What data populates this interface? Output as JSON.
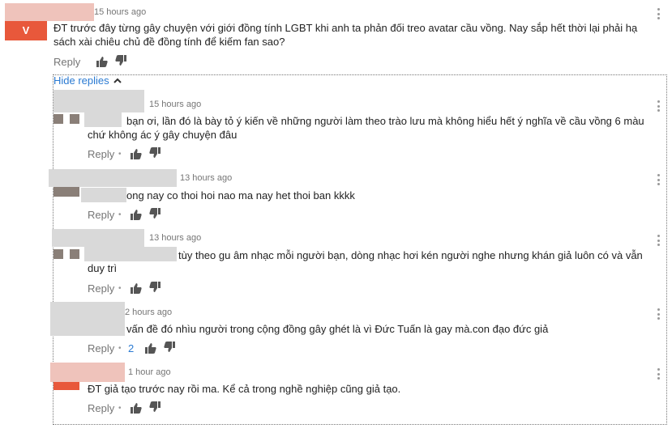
{
  "top_comment": {
    "avatar_letter": "V",
    "time": "15 hours ago",
    "text_line1": "ĐT trước đây từng gây chuyện với giới đồng tính LGBT khi anh ta phản đối treo avatar cầu vồng. Nay sắp hết thời lại phải hạ",
    "text_line2": "sách xài chiêu chủ đề đồng tính để kiếm fan sao?",
    "reply_label": "Reply"
  },
  "hide_replies_label": "Hide replies",
  "replies": [
    {
      "time": "15 hours ago",
      "text_line1": "bạn ơi, lần đó là bày tỏ ý kiến về những người làm theo trào lưu mà không hiểu hết ý nghĩa về cầu vồng 6 màu",
      "text_line2": "chứ không ác ý gây chuyện đâu",
      "reply_label": "Reply",
      "separator": "•"
    },
    {
      "time": "13 hours ago",
      "text_line1": "ong nay co thoi hoi nao ma nay het thoi ban kkkk",
      "reply_label": "Reply",
      "separator": "•"
    },
    {
      "time": "13 hours ago",
      "text_line1": "tùy theo gu âm nhạc mỗi người bạn, dòng nhạc hơi kén người nghe nhưng khán giả luôn có và vẫn",
      "text_line2": "duy trì",
      "reply_label": "Reply",
      "separator": "•"
    },
    {
      "time": "2 hours ago",
      "text_line1": "vấn đề đó nhìu người trong cộng đồng gây ghét là vì Đức Tuấn là gay mà.con đạo đức giả",
      "reply_label": "Reply",
      "separator": "•",
      "like_count": "2"
    },
    {
      "time": "1 hour ago",
      "text_line1": "ĐT giả tạo trước nay rồi ma. Kể cả trong nghề nghiệp cũng giả tạo.",
      "reply_label": "Reply",
      "separator": "•"
    }
  ],
  "colors": {
    "link": "#2a7ad2",
    "avatar_orange": "#e8583b",
    "muted": "#767676"
  },
  "icons": [
    "thumbs-up-icon",
    "thumbs-down-icon",
    "more-options-icon",
    "chevron-up-icon"
  ]
}
